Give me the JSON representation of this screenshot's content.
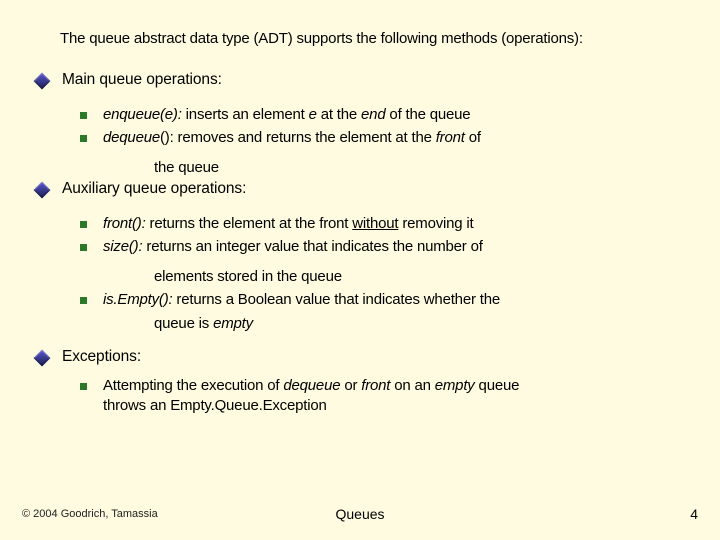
{
  "intro": "The queue abstract data type (ADT) supports the following methods (operations):",
  "sections": {
    "main": {
      "label": "Main queue operations:",
      "items": {
        "enqueue": {
          "name": "enqueue(e):",
          "desc_a": " inserts an element ",
          "var": "e",
          "desc_b": "  at the ",
          "em": "end",
          "desc_c": " of the queue"
        },
        "dequeue": {
          "name": "dequeue",
          "paren": "(): ",
          "desc_a": "removes and returns the element at the ",
          "em": "front",
          "desc_b": " of",
          "cont": "the queue"
        }
      }
    },
    "aux": {
      "label": "Auxiliary queue operations:",
      "items": {
        "front": {
          "name": "front():",
          "desc_a": " returns the element at the front ",
          "em": "without",
          "desc_b": " removing it"
        },
        "size": {
          "name": "size():",
          "desc_a": " returns an integer value that indicates the number of",
          "cont": "elements stored in the queue"
        },
        "isempty": {
          "name": "is.Empty():",
          "desc_a": " returns a Boolean value that indicates whether the",
          "cont_a": "queue is ",
          "cont_em": "empty"
        }
      }
    },
    "exc": {
      "label": "Exceptions:",
      "items": {
        "attempt": {
          "a": "Attempting the execution of ",
          "em1": "dequeue",
          "b": " or ",
          "em2": "front",
          "c": " on an ",
          "em3": "empty",
          "d": " queue",
          "cont": "throws an Empty.Queue.Exception"
        }
      }
    }
  },
  "footer": {
    "copyright": "© 2004 Goodrich, Tamassia",
    "title": "Queues",
    "page": "4"
  }
}
